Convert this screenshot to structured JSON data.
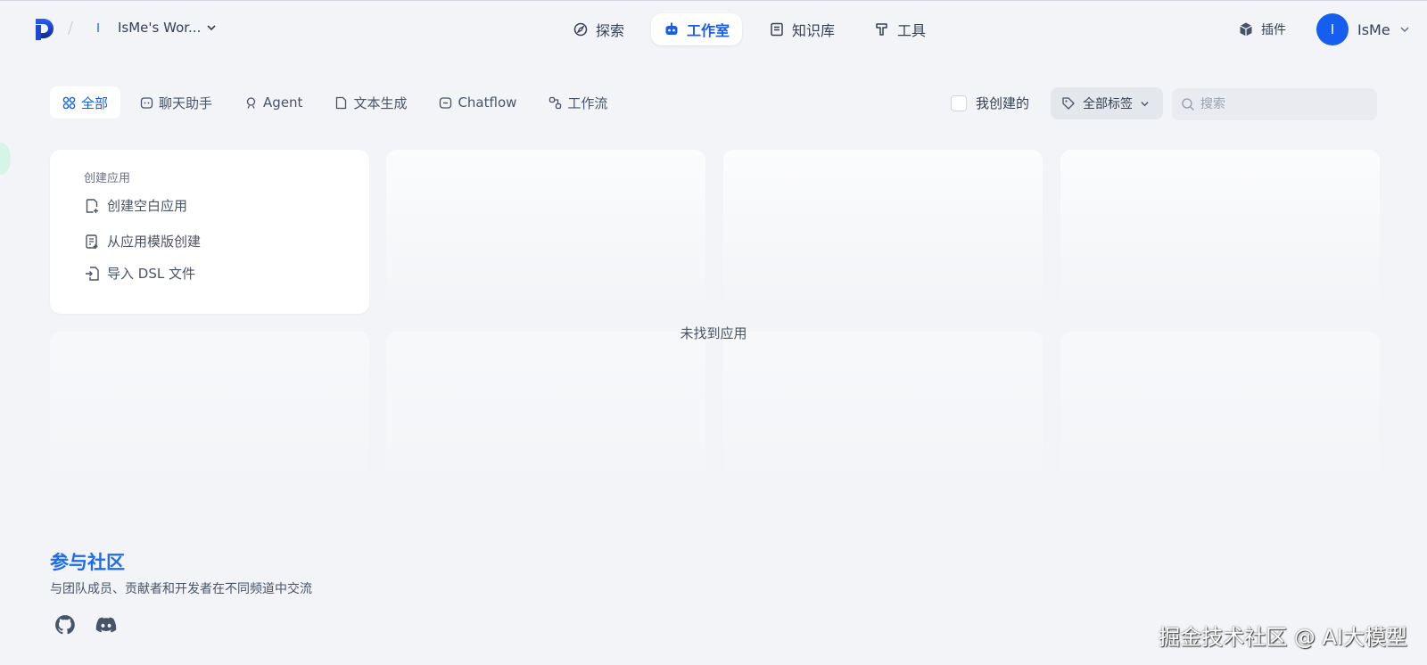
{
  "header": {
    "workspace_initial": "I",
    "workspace_name": "IsMe's Wor...",
    "nav": [
      {
        "label": "探索",
        "icon": "compass-icon"
      },
      {
        "label": "工作室",
        "icon": "robot-icon",
        "active": true
      },
      {
        "label": "知识库",
        "icon": "book-icon"
      },
      {
        "label": "工具",
        "icon": "hammer-icon"
      }
    ],
    "plugins_label": "插件",
    "user_initial": "I",
    "user_name": "IsMe"
  },
  "filters": [
    {
      "label": "全部",
      "icon": "grid-icon",
      "active": true
    },
    {
      "label": "聊天助手",
      "icon": "chat-icon"
    },
    {
      "label": "Agent",
      "icon": "agent-icon"
    },
    {
      "label": "文本生成",
      "icon": "document-icon"
    },
    {
      "label": "Chatflow",
      "icon": "chatflow-icon"
    },
    {
      "label": "工作流",
      "icon": "workflow-icon"
    }
  ],
  "toolbar": {
    "mine_label": "我创建的",
    "tags_label": "全部标签",
    "search_placeholder": "搜索"
  },
  "create": {
    "title": "创建应用",
    "items": [
      {
        "label": "创建空白应用",
        "icon": "file-plus-icon"
      },
      {
        "label": "从应用模版创建",
        "icon": "template-icon"
      },
      {
        "label": "导入 DSL 文件",
        "icon": "import-icon"
      }
    ]
  },
  "empty_state": "未找到应用",
  "community": {
    "title": "参与社区",
    "description": "与团队成员、贡献者和开发者在不同频道中交流",
    "links": [
      "github-icon",
      "discord-icon"
    ]
  },
  "watermark": "掘金技术社区 @ AI大模型",
  "colors": {
    "accent": "#155eef",
    "background": "#f2f4f7",
    "community_title": "#1d6cf0"
  }
}
